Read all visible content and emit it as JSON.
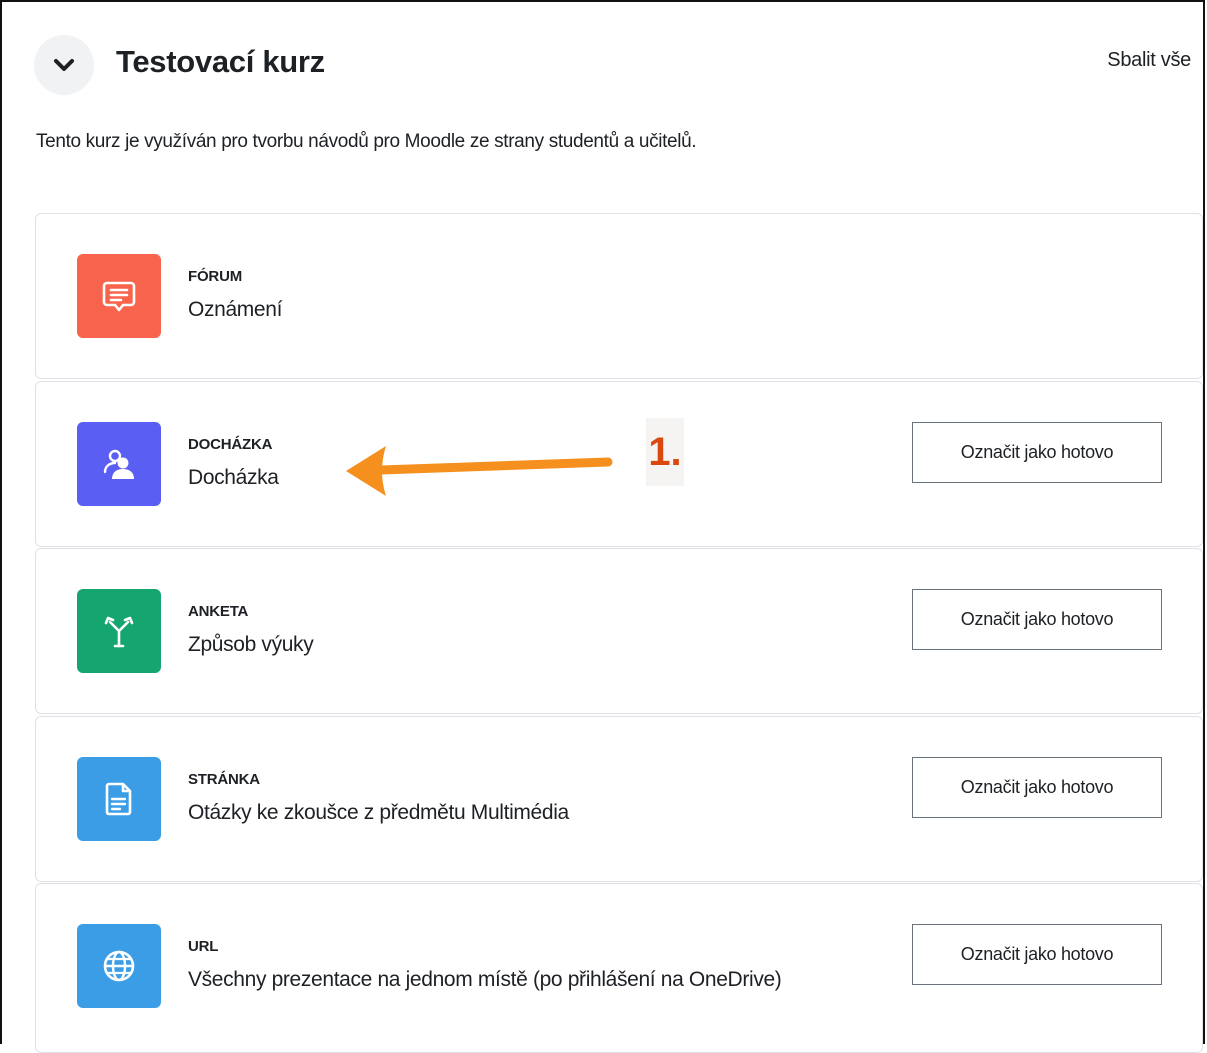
{
  "course": {
    "title": "Testovací kurz",
    "collapse_all": "Sbalit vše",
    "description": "Tento kurz je využíván pro tvorbu návodů pro Moodle ze strany studentů a učitelů."
  },
  "activities": [
    {
      "type": "FÓRUM",
      "name": "Oznámení",
      "icon": "forum-icon",
      "color": "#f7634d",
      "has_button": false
    },
    {
      "type": "DOCHÁZKA",
      "name": "Docházka",
      "icon": "attendance-icon",
      "color": "#5b5ef3",
      "has_button": true,
      "button": "Označit jako hotovo"
    },
    {
      "type": "ANKETA",
      "name": "Způsob výuky",
      "icon": "choice-icon",
      "color": "#15a56f",
      "has_button": true,
      "button": "Označit jako hotovo"
    },
    {
      "type": "STRÁNKA",
      "name": "Otázky ke zkoušce z předmětu Multimédia",
      "icon": "page-icon",
      "color": "#3b9de6",
      "has_button": true,
      "button": "Označit jako hotovo"
    },
    {
      "type": "URL",
      "name": "Všechny prezentace na jednom místě (po přihlášení na OneDrive)",
      "icon": "url-icon",
      "color": "#3b9de6",
      "has_button": true,
      "button": "Označit jako hotovo"
    }
  ],
  "annotation": {
    "label": "1.",
    "color": "#f5901e"
  }
}
